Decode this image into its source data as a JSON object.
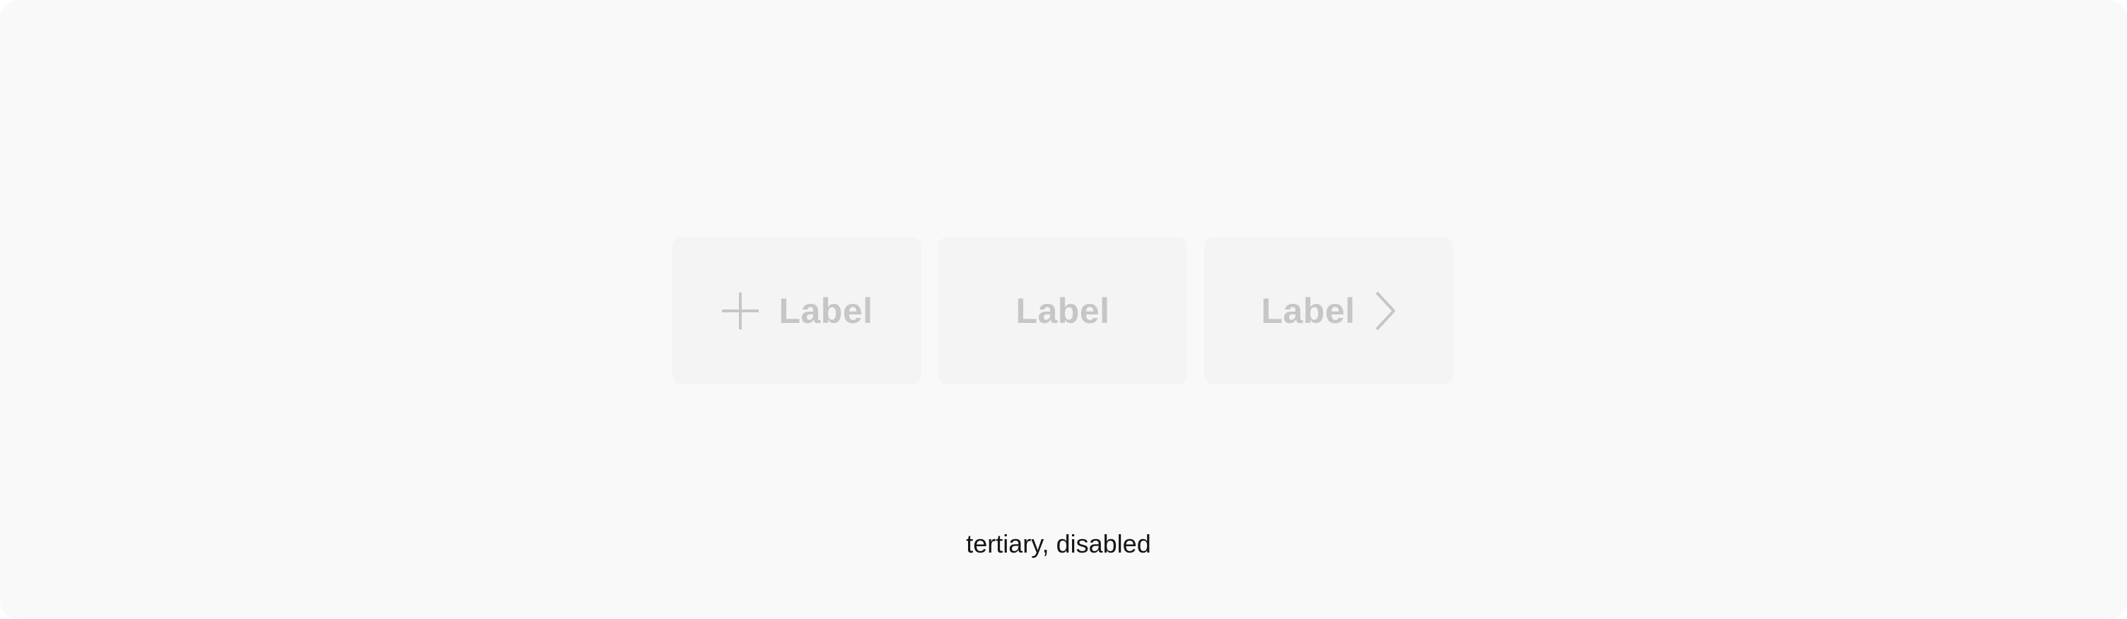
{
  "buttons": [
    {
      "label": "Label",
      "leading_icon": "add-icon",
      "trailing_icon": null,
      "state": "disabled"
    },
    {
      "label": "Label",
      "leading_icon": null,
      "trailing_icon": null,
      "state": "disabled"
    },
    {
      "label": "Label",
      "leading_icon": null,
      "trailing_icon": "chevron-right-icon",
      "state": "disabled"
    }
  ],
  "caption": "tertiary, disabled",
  "colors": {
    "canvas_background": "#f9f9f9",
    "button_background": "#f4f4f4",
    "disabled_text": "#c6c6c6",
    "caption_text": "#161616"
  }
}
